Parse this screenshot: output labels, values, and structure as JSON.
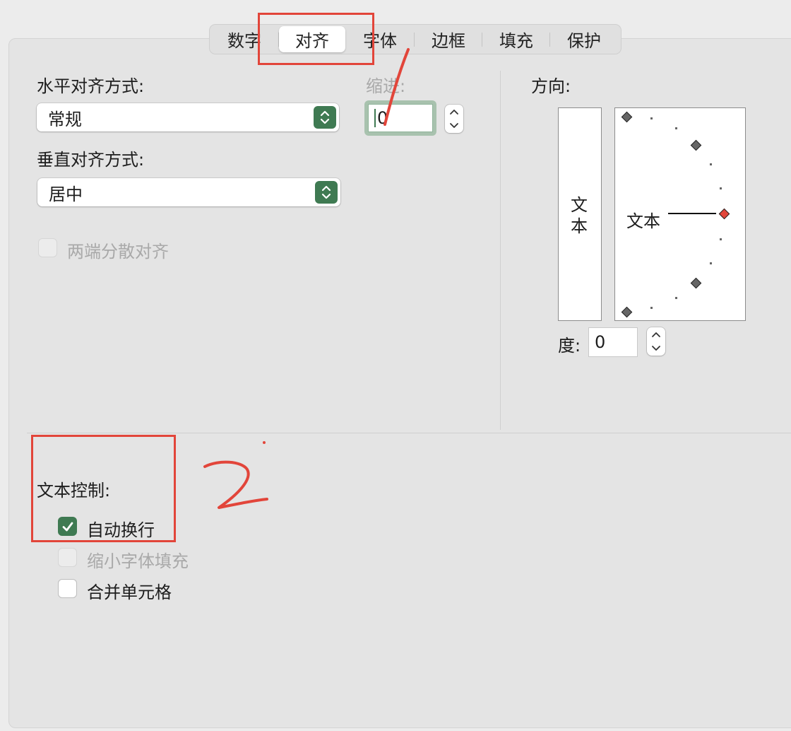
{
  "tabs": [
    "数字",
    "对齐",
    "字体",
    "边框",
    "填充",
    "保护"
  ],
  "active_tab": "对齐",
  "horizontal": {
    "label": "水平对齐方式:",
    "value": "常规"
  },
  "vertical": {
    "label": "垂直对齐方式:",
    "value": "居中"
  },
  "indent": {
    "label": "缩进:",
    "value": "0"
  },
  "justify_distributed": {
    "label": "两端分散对齐",
    "checked": false,
    "enabled": false
  },
  "orientation": {
    "label": "方向:",
    "vertical_text": [
      "文",
      "本"
    ],
    "dial_text": "文本",
    "degrees_label": "度:",
    "degrees_value": "0"
  },
  "text_control": {
    "label": "文本控制:",
    "wrap": {
      "label": "自动换行",
      "checked": true
    },
    "shrink": {
      "label": "缩小字体填充",
      "checked": false,
      "enabled": false
    },
    "merge": {
      "label": "合并单元格",
      "checked": false
    }
  },
  "annotations": {
    "mark_1": "1",
    "mark_2": "2"
  },
  "colors": {
    "accent": "#3f7a52",
    "annotation": "#e2453a",
    "panel": "#e4e4e4"
  }
}
